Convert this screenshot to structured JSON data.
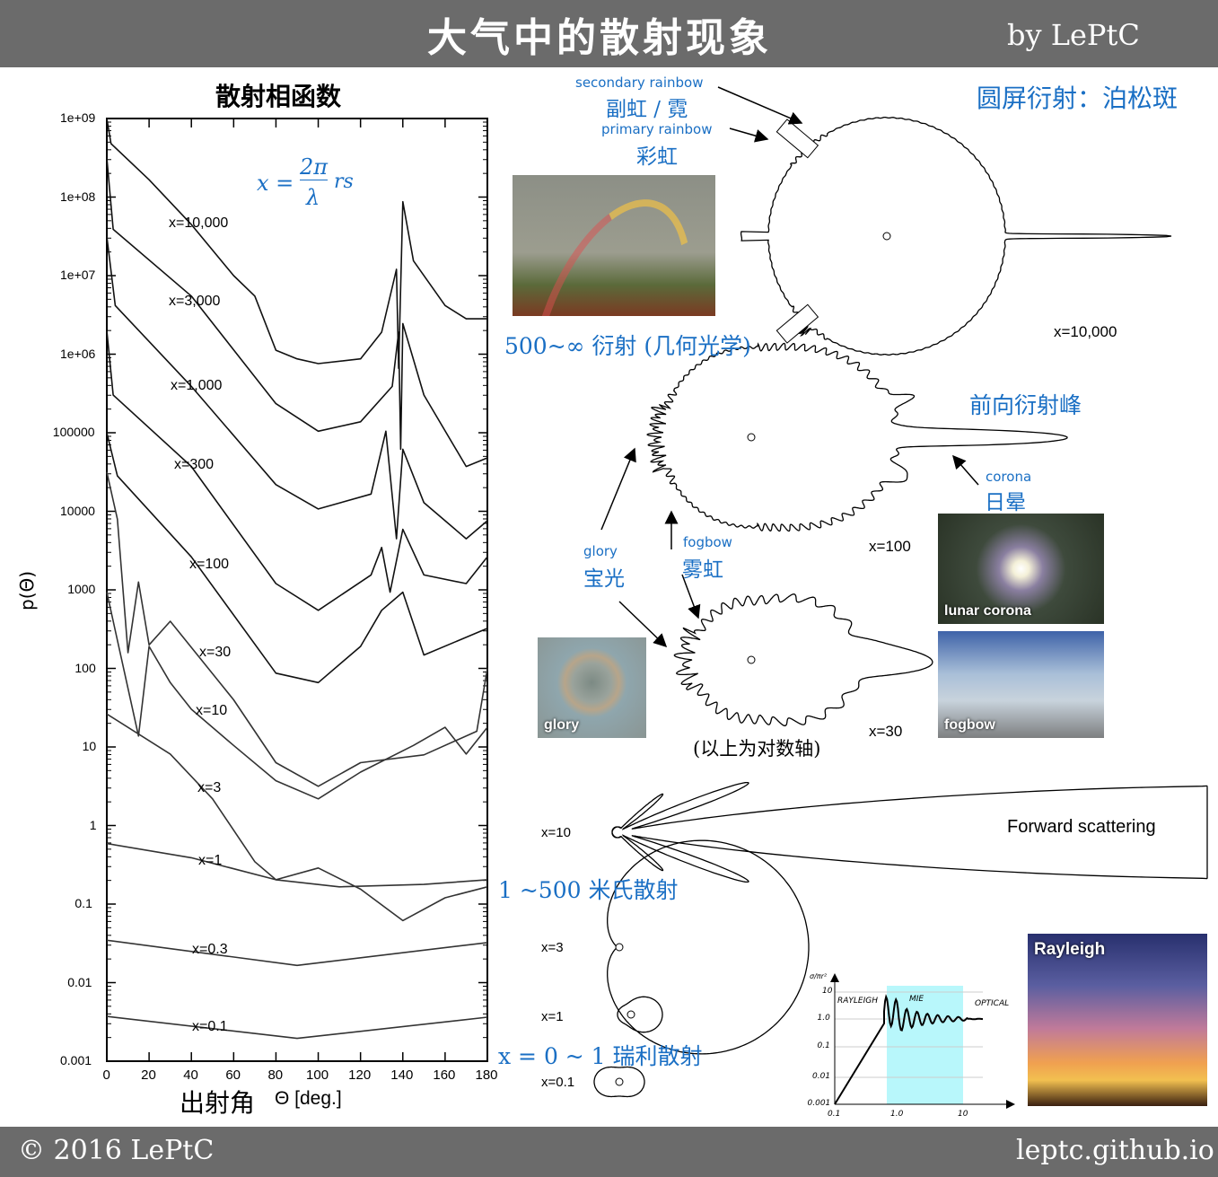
{
  "header": {
    "title": "大气中的散射现象",
    "author": "by LePtC"
  },
  "footer": {
    "copyright": "© 2016 LePtC",
    "site": "leptc.github.io"
  },
  "formula": {
    "lhs": "x =",
    "num": "2π",
    "den": "λ",
    "rhs": "rs"
  },
  "chart_data": {
    "type": "line",
    "title": "散射相函数",
    "xlabel": "出射角  Θ [deg.]",
    "xlabel_cn": "出射角",
    "xlabel_en": "Θ [deg.]",
    "ylabel": "p(Θ)",
    "xlim": [
      0,
      180
    ],
    "ylim": [
      0.001,
      1000000000
    ],
    "yscale": "log",
    "xticks": [
      "0",
      "20",
      "40",
      "60",
      "80",
      "100",
      "120",
      "140",
      "160",
      "180"
    ],
    "yticks": [
      "1e+09",
      "1e+08",
      "1e+07",
      "1e+06",
      "100000",
      "10000",
      "1000",
      "100",
      "10",
      "1",
      "0.1",
      "0.01",
      "0.001"
    ],
    "series": [
      {
        "name": "x=10,000",
        "log10_p": [
          [
            0,
            9
          ],
          [
            2,
            8.68
          ],
          [
            20,
            8.22
          ],
          [
            40,
            7.65
          ],
          [
            60,
            7.0
          ],
          [
            70,
            6.74
          ],
          [
            80,
            6.05
          ],
          [
            90,
            5.94
          ],
          [
            100,
            5.88
          ],
          [
            120,
            5.94
          ],
          [
            130,
            6.28
          ],
          [
            137,
            7.08
          ],
          [
            138,
            5.82
          ],
          [
            140,
            7.94
          ],
          [
            145,
            7.19
          ],
          [
            160,
            6.62
          ],
          [
            170,
            6.45
          ],
          [
            180,
            6.45
          ]
        ]
      },
      {
        "name": "x=3,000",
        "log10_p": [
          [
            0,
            8.5
          ],
          [
            3,
            7.59
          ],
          [
            40,
            6.74
          ],
          [
            80,
            5.37
          ],
          [
            100,
            5.02
          ],
          [
            120,
            5.14
          ],
          [
            135,
            5.59
          ],
          [
            138,
            6.28
          ],
          [
            139,
            4.79
          ],
          [
            140,
            6.39
          ],
          [
            150,
            5.48
          ],
          [
            170,
            4.57
          ],
          [
            180,
            4.68
          ]
        ]
      },
      {
        "name": "x=1,000",
        "log10_p": [
          [
            0,
            7.5
          ],
          [
            4,
            6.62
          ],
          [
            40,
            5.59
          ],
          [
            80,
            4.34
          ],
          [
            100,
            4.03
          ],
          [
            125,
            4.22
          ],
          [
            132,
            5.02
          ],
          [
            137,
            3.65
          ],
          [
            140,
            4.79
          ],
          [
            150,
            4.11
          ],
          [
            170,
            3.65
          ],
          [
            180,
            3.88
          ]
        ]
      },
      {
        "name": "x=300",
        "log10_p": [
          [
            0,
            6.3
          ],
          [
            3,
            5.48
          ],
          [
            40,
            4.57
          ],
          [
            80,
            3.08
          ],
          [
            100,
            2.74
          ],
          [
            125,
            3.19
          ],
          [
            130,
            3.54
          ],
          [
            134,
            2.97
          ],
          [
            140,
            3.77
          ],
          [
            150,
            3.19
          ],
          [
            170,
            3.08
          ],
          [
            180,
            3.42
          ]
        ]
      },
      {
        "name": "x=100",
        "log10_p": [
          [
            0,
            5.0
          ],
          [
            5,
            4.45
          ],
          [
            40,
            3.42
          ],
          [
            80,
            1.94
          ],
          [
            100,
            1.82
          ],
          [
            120,
            2.28
          ],
          [
            130,
            2.74
          ],
          [
            140,
            2.97
          ],
          [
            150,
            2.17
          ],
          [
            180,
            2.51
          ]
        ]
      },
      {
        "name": "x=30",
        "log10_p": [
          [
            0,
            4.5
          ],
          [
            5,
            3.9
          ],
          [
            10,
            2.2
          ],
          [
            15,
            3.1
          ],
          [
            20,
            2.3
          ],
          [
            30,
            2.6
          ],
          [
            60,
            1.6
          ],
          [
            80,
            0.8
          ],
          [
            100,
            0.5
          ],
          [
            120,
            0.8
          ],
          [
            150,
            0.9
          ],
          [
            175,
            1.2
          ],
          [
            180,
            2.0
          ]
        ]
      },
      {
        "name": "x=10",
        "log10_p": [
          [
            0,
            2.97
          ],
          [
            15,
            1.14
          ],
          [
            20,
            2.28
          ],
          [
            30,
            1.82
          ],
          [
            40,
            1.48
          ],
          [
            60,
            1.02
          ],
          [
            80,
            0.57
          ],
          [
            100,
            0.34
          ],
          [
            120,
            0.68
          ],
          [
            145,
            1.02
          ],
          [
            160,
            1.25
          ],
          [
            170,
            0.91
          ],
          [
            180,
            1.25
          ]
        ]
      },
      {
        "name": "x=3",
        "log10_p": [
          [
            0,
            1.42
          ],
          [
            30,
            0.91
          ],
          [
            50,
            0.34
          ],
          [
            70,
            -0.46
          ],
          [
            80,
            -0.69
          ],
          [
            100,
            -0.54
          ],
          [
            120,
            -0.81
          ],
          [
            140,
            -1.21
          ],
          [
            160,
            -0.92
          ],
          [
            180,
            -0.78
          ]
        ]
      },
      {
        "name": "x=1",
        "log10_p": [
          [
            0,
            -0.23
          ],
          [
            40,
            -0.41
          ],
          [
            80,
            -0.69
          ],
          [
            110,
            -0.78
          ],
          [
            150,
            -0.75
          ],
          [
            180,
            -0.69
          ]
        ]
      },
      {
        "name": "x=0.3",
        "log10_p": [
          [
            0,
            -1.46
          ],
          [
            90,
            -1.78
          ],
          [
            180,
            -1.49
          ]
        ]
      },
      {
        "name": "x=0.1",
        "log10_p": [
          [
            0,
            -2.43
          ],
          [
            90,
            -2.71
          ],
          [
            180,
            -2.44
          ]
        ]
      }
    ]
  },
  "right": {
    "secondary_rainbow_en": "secondary rainbow",
    "secondary_rainbow_cn": "副虹 / 霓",
    "primary_rainbow_en": "primary rainbow",
    "primary_rainbow_cn": "彩虹",
    "poisson": "圆屏衍射：泊松斑",
    "geo": "500~∞ 衍射 (几何光学)",
    "forward_peak": "前向衍射峰",
    "corona_en": "corona",
    "corona_cn": "日晕",
    "glory_en": "glory",
    "glory_cn": "宝光",
    "fogbow_en": "fogbow",
    "fogbow_cn": "雾虹",
    "log_note": "(以上为对数轴)",
    "mie": "1 ~500 米氏散射",
    "rayleigh": "x = 0 ~ 1 瑞利散射",
    "forward_scattering": "Forward scattering",
    "labels": {
      "x10000": "x=10,000",
      "x100": "x=100",
      "x30": "x=30",
      "x10": "x=10",
      "x3": "x=3",
      "x1": "x=1",
      "x01": "x=0.1"
    },
    "photos": {
      "lunar": "lunar corona",
      "fogbow": "fogbow",
      "glory": "glory",
      "rayleigh": "Rayleigh"
    }
  },
  "cross_section": {
    "ylabel": "σ/πr²",
    "regions": [
      "RAYLEIGH",
      "MIE",
      "OPTICAL"
    ],
    "yticks": [
      "10",
      "1.0",
      "0.1",
      "0.01",
      "0.001"
    ],
    "xticks": [
      "0.1",
      "1.0",
      "10"
    ]
  },
  "colors": {
    "header": "#6b6b6b",
    "accent": "#1a6fc4",
    "mie_band": "#b8f7fb"
  }
}
